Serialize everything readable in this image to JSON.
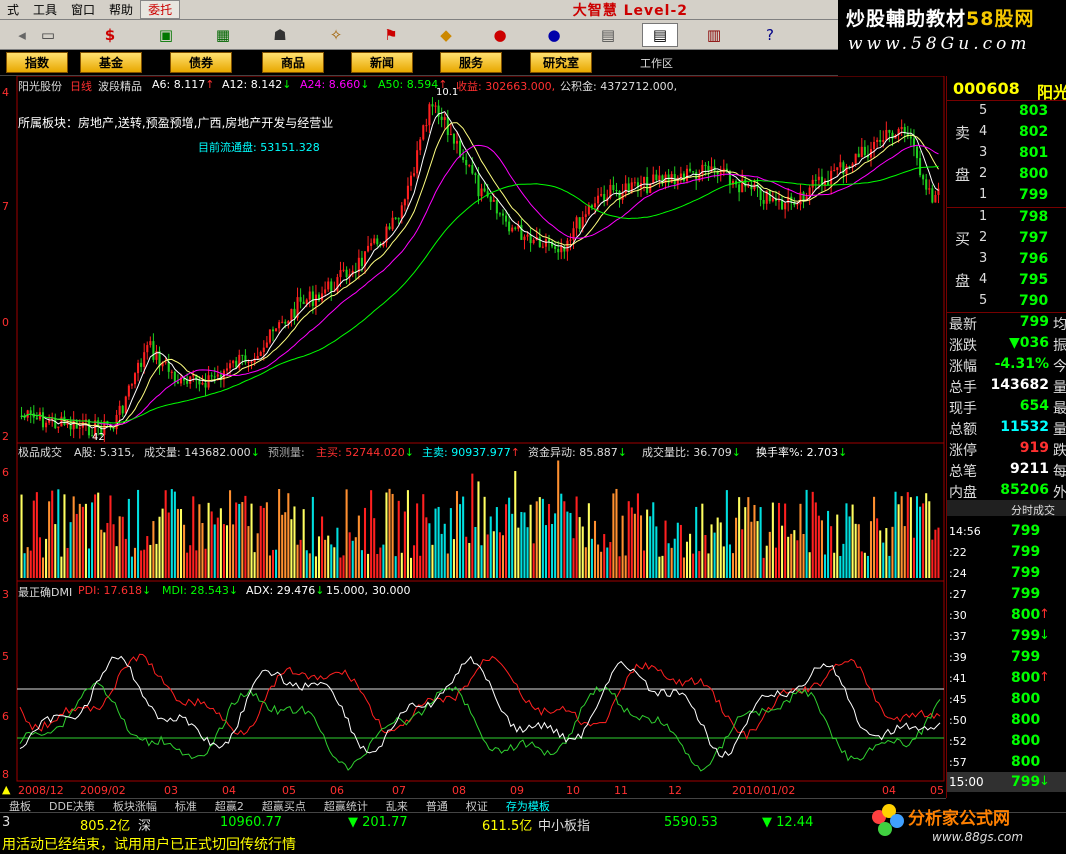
{
  "menu": {
    "items": [
      "式",
      "工具",
      "窗口",
      "帮助",
      "委托"
    ],
    "active": "委托",
    "title": "大智慧 Level-2"
  },
  "logo": {
    "line1": "炒股輔助教材",
    "line1_accent": "58股网",
    "line2": "www.58Gu.com"
  },
  "categories": [
    "指数",
    "基金",
    "债券",
    "商品",
    "新闻",
    "服务",
    "研究室"
  ],
  "workarea": "工作区",
  "header": {
    "stock_name": "阳光股份",
    "period": "日线",
    "indicator": "波段精品",
    "ma": [
      {
        "label": "A6: 8.117",
        "arrow": "↑",
        "color": "#ffffff"
      },
      {
        "label": "A12: 8.142",
        "arrow": "↓",
        "color": "#ffffff"
      },
      {
        "label": "A24: 8.660",
        "arrow": "↓",
        "color": "#ff00ff"
      },
      {
        "label": "A50: 8.594",
        "arrow": "↑",
        "color": "#00ff00"
      }
    ],
    "shouyi": "收益: 302663.000,",
    "gongjijin": "公积金: 4372712.000,"
  },
  "sector_text": "所属板块：房地产,送转,预盈预增,广西,房地产开发与经营业",
  "float_text": "目前流通盘: 53151.328",
  "high_label": "10.1",
  "low_label": "42",
  "price_axis": [
    "4",
    "7",
    "0",
    "2"
  ],
  "vol_header": {
    "name": "极品成交",
    "a": "A股: 5.315,",
    "vol": "成交量: 143682.000",
    "yc": "预测量:",
    "zhumai": "主买: 52744.020",
    "zhumai2": "主卖: 90937.977",
    "zjyd": "资金异动: 85.887",
    "cjlb": "成交量比: 36.709",
    "hsl": "换手率%: 2.703"
  },
  "vol_axis": [
    "6",
    "8"
  ],
  "dmi_header": {
    "name": "最正确DMI",
    "pdi": "PDI: 17.618",
    "mdi": "MDI: 28.543",
    "adx": "ADX: 29.476",
    "l1": "15.000,",
    "l2": "30.000"
  },
  "dmi_axis": [
    "3",
    "5",
    "6",
    "8"
  ],
  "dates": [
    "2008/12",
    "2009/02",
    "03",
    "04",
    "05",
    "06",
    "07",
    "08",
    "09",
    "10",
    "11",
    "12",
    "2010/01/02",
    "04",
    "05"
  ],
  "quote": {
    "code": "000608",
    "name": "阳光",
    "sell_label": [
      "卖",
      "盘"
    ],
    "buy_label": [
      "买",
      "盘"
    ],
    "sell": [
      {
        "n": "5",
        "p": "803"
      },
      {
        "n": "4",
        "p": "802"
      },
      {
        "n": "3",
        "p": "801"
      },
      {
        "n": "2",
        "p": "800"
      },
      {
        "n": "1",
        "p": "799"
      }
    ],
    "buy": [
      {
        "n": "1",
        "p": "798"
      },
      {
        "n": "2",
        "p": "797"
      },
      {
        "n": "3",
        "p": "796"
      },
      {
        "n": "4",
        "p": "795"
      },
      {
        "n": "5",
        "p": "790"
      }
    ],
    "stats": [
      {
        "k": "最新",
        "v": "799",
        "c": "#00ff00",
        "e": "均"
      },
      {
        "k": "涨跌",
        "v": "▼036",
        "c": "#00ff00",
        "e": "振"
      },
      {
        "k": "涨幅",
        "v": "-4.31%",
        "c": "#00ff00",
        "e": "今"
      },
      {
        "k": "总手",
        "v": "143682",
        "c": "#ffffff",
        "e": "量"
      },
      {
        "k": "现手",
        "v": "654",
        "c": "#00ff00",
        "e": "最"
      },
      {
        "k": "总额",
        "v": "11532",
        "c": "#00ffff",
        "e": "量"
      },
      {
        "k": "涨停",
        "v": "919",
        "c": "#ff3030",
        "e": "跌"
      },
      {
        "k": "总笔",
        "v": "9211",
        "c": "#ffffff",
        "e": "每"
      },
      {
        "k": "内盘",
        "v": "85206",
        "c": "#00ff00",
        "e": "外"
      }
    ],
    "ticks_title": "分时成交",
    "ticks": [
      {
        "t": "14:56",
        "p": "799",
        "a": ""
      },
      {
        "t": ":22",
        "p": "799",
        "a": ""
      },
      {
        "t": ":24",
        "p": "799",
        "a": ""
      },
      {
        "t": ":27",
        "p": "799",
        "a": ""
      },
      {
        "t": ":30",
        "p": "800",
        "a": "↑"
      },
      {
        "t": ":37",
        "p": "799",
        "a": "↓"
      },
      {
        "t": ":39",
        "p": "799",
        "a": ""
      },
      {
        "t": ":41",
        "p": "800",
        "a": "↑"
      },
      {
        "t": ":45",
        "p": "800",
        "a": ""
      },
      {
        "t": ":50",
        "p": "800",
        "a": ""
      },
      {
        "t": ":52",
        "p": "800",
        "a": ""
      },
      {
        "t": ":57",
        "p": "800",
        "a": ""
      }
    ],
    "last": {
      "t": "15:00",
      "p": "799",
      "a": "↓"
    }
  },
  "statusbar": {
    "items": [
      "盘板",
      "DDE决策",
      "板块涨幅",
      "标准",
      "超赢2",
      "超赢买点",
      "超赢统计",
      "乱来",
      "普通",
      "权证",
      "存为模板"
    ],
    "active": "存为模板"
  },
  "indexbar": {
    "v1": "805.2亿",
    "l1": "深",
    "v2": "10960.77",
    "v3": "▼ 201.77",
    "v4": "611.5亿",
    "l2": "中小板指",
    "v5": "5590.53",
    "v6": "▼ 12.44"
  },
  "message": "用活动已经结束，试用用户已正式切回传统行情",
  "watermark": {
    "text": "分析家公式网",
    "url": "www.88gs.com"
  }
}
